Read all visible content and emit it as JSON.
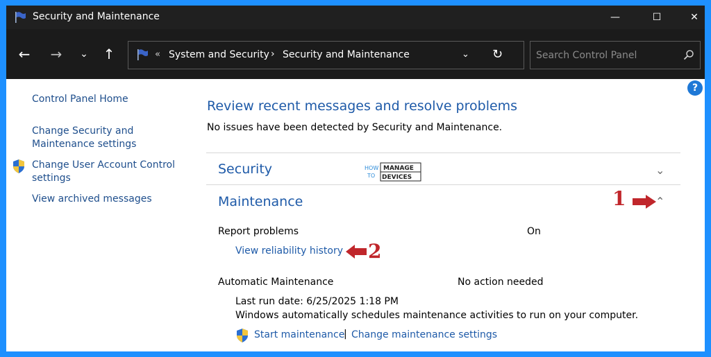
{
  "window": {
    "title": "Security and Maintenance",
    "minimize_glyph": "—",
    "maximize_glyph": "☐",
    "close_glyph": "✕"
  },
  "nav": {
    "back_glyph": "←",
    "forward_glyph": "→",
    "recent_glyph": "⌄",
    "up_glyph": "↑",
    "address_chevron": "«",
    "breadcrumb": [
      "System and Security",
      "Security and Maintenance"
    ],
    "breadcrumb_sep": "›",
    "dropdown_glyph": "⌄",
    "refresh_glyph": "↻",
    "search_placeholder": "Search Control Panel"
  },
  "help_label": "?",
  "left_pane": {
    "home": "Control Panel Home",
    "change_settings": "Change Security and Maintenance settings",
    "uac": "Change User Account Control settings",
    "archived": "View archived messages"
  },
  "main": {
    "heading": "Review recent messages and resolve problems",
    "subtitle": "No issues have been detected by Security and Maintenance.",
    "security_title": "Security",
    "maintenance_title": "Maintenance",
    "chevron_down": "⌄",
    "chevron_up": "⌃",
    "report_problems": {
      "label": "Report problems",
      "status": "On",
      "link": "View reliability history"
    },
    "automatic_maintenance": {
      "label": "Automatic Maintenance",
      "status": "No action needed",
      "last_run": "Last run date: 6/25/2025 1:18 PM",
      "description": "Windows automatically schedules maintenance activities to run on your computer.",
      "start_link": "Start maintenance",
      "separator": "|",
      "change_link": "Change maintenance settings"
    }
  },
  "logo": {
    "how": "HOW",
    "to": "TO",
    "manage": "MANAGE",
    "devices": "DEVICES"
  },
  "annotations": {
    "one": "1",
    "two": "2",
    "color": "#c0262b"
  },
  "colors": {
    "link": "#1e5aa8",
    "titlebar": "#202020",
    "frame": "#1e90ff"
  }
}
